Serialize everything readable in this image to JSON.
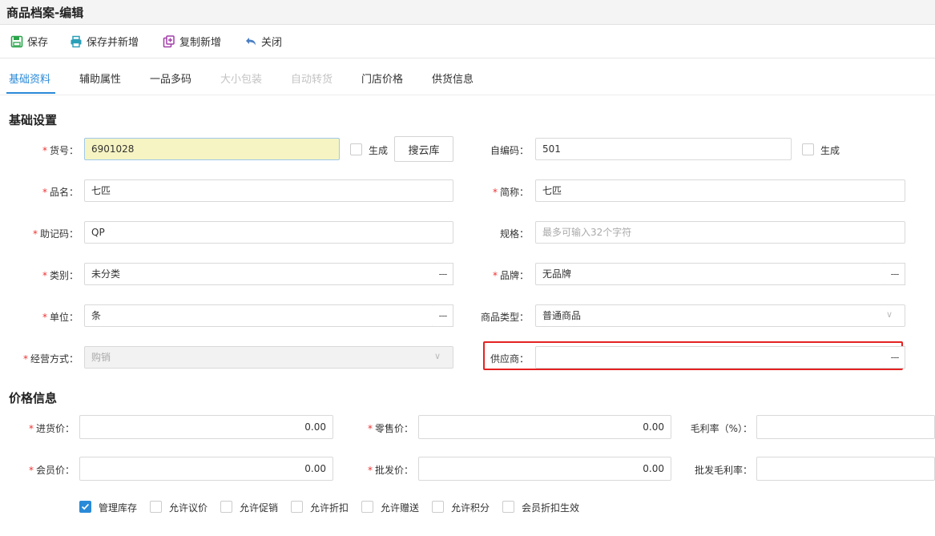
{
  "window_title": "商品档案-编辑",
  "toolbar": {
    "save": "保存",
    "save_new": "保存并新增",
    "copy_new": "复制新增",
    "close": "关闭"
  },
  "tabs": [
    "基础资料",
    "辅助属性",
    "一品多码",
    "大小包装",
    "自动转货",
    "门店价格",
    "供货信息"
  ],
  "basic": {
    "section_title": "基础设置",
    "code_label": "货号",
    "code_value": "6901028",
    "generate_label": "生成",
    "cloud_search": "搜云库",
    "selfcode_label": "自编码",
    "selfcode_value": "501",
    "generate_label2": "生成",
    "name_label": "品名",
    "name_value": "七匹",
    "short_label": "简称",
    "short_value": "七匹",
    "mnemonic_label": "助记码",
    "mnemonic_value": "QP",
    "spec_label": "规格",
    "spec_placeholder": "最多可输入32个字符",
    "category_label": "类别",
    "category_value": "未分类",
    "brand_label": "品牌",
    "brand_value": "无品牌",
    "unit_label": "单位",
    "unit_value": "条",
    "type_label": "商品类型",
    "type_value": "普通商品",
    "mode_label": "经营方式",
    "mode_value": "购销",
    "supplier_label": "供应商",
    "supplier_value": "",
    "more_btn": "---"
  },
  "price": {
    "section_title": "价格信息",
    "purchase_label": "进货价",
    "purchase_value": "0.00",
    "retail_label": "零售价",
    "retail_value": "0.00",
    "margin_label": "毛利率（%）",
    "member_label": "会员价",
    "member_value": "0.00",
    "wholesale_label": "批发价",
    "wholesale_value": "0.00",
    "wholesale_margin_label": "批发毛利率"
  },
  "options": [
    {
      "label": "管理库存",
      "checked": true
    },
    {
      "label": "允许议价",
      "checked": false
    },
    {
      "label": "允许促销",
      "checked": false
    },
    {
      "label": "允许折扣",
      "checked": false
    },
    {
      "label": "允许赠送",
      "checked": false
    },
    {
      "label": "允许积分",
      "checked": false
    },
    {
      "label": "会员折扣生效",
      "checked": false
    }
  ],
  "colors": {
    "accent": "#2a8ad8",
    "required": "#e33333",
    "highlight_box": "#e52222"
  }
}
